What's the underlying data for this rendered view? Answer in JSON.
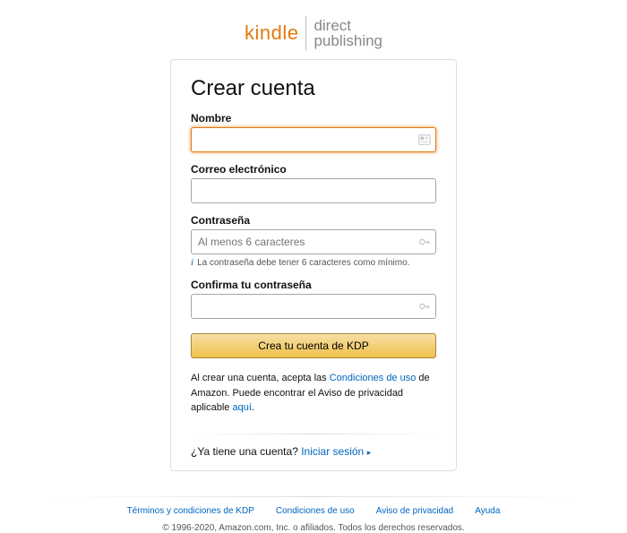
{
  "logo": {
    "left": "kindle",
    "right_top": "direct",
    "right_bottom": "publishing"
  },
  "form": {
    "title": "Crear cuenta",
    "name": {
      "label": "Nombre",
      "value": ""
    },
    "email": {
      "label": "Correo electrónico",
      "value": ""
    },
    "password": {
      "label": "Contraseña",
      "placeholder": "Al menos 6 caracteres",
      "hint": "La contraseña debe tener 6 caracteres como mínimo."
    },
    "confirm": {
      "label": "Confirma tu contraseña"
    },
    "submit": "Crea tu cuenta de KDP",
    "legal_pre": "Al crear una cuenta, acepta las ",
    "legal_link1": "Condiciones de uso",
    "legal_mid": " de Amazon. Puede encontrar el Aviso de privacidad aplicable ",
    "legal_link2": "aquí",
    "legal_post": ".",
    "signin_q": "¿Ya tiene una cuenta? ",
    "signin_link": "Iniciar sesión"
  },
  "footer": {
    "links": [
      "Términos y condiciones de KDP",
      "Condiciones de uso",
      "Aviso de privacidad",
      "Ayuda"
    ],
    "copyright": "© 1996-2020, Amazon.com, Inc. o afiliados. Todos los derechos reservados."
  }
}
